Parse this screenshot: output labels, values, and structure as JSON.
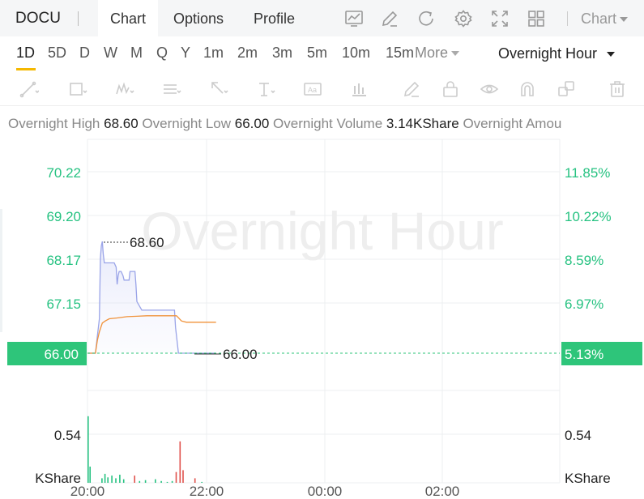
{
  "header": {
    "symbol": "DOCU",
    "tabs": [
      {
        "label": "Chart",
        "active": true
      },
      {
        "label": "Options",
        "active": false
      },
      {
        "label": "Profile",
        "active": false
      }
    ],
    "icons": [
      "chart-line-icon",
      "pencil-icon",
      "refresh-icon",
      "gear-icon",
      "fullscreen-icon",
      "grid-layout-icon"
    ],
    "chart_selector": "Chart"
  },
  "periods": {
    "items": [
      "1D",
      "5D",
      "D",
      "W",
      "M",
      "Q",
      "Y",
      "1m",
      "2m",
      "3m",
      "5m",
      "10m",
      "15m"
    ],
    "active": "1D",
    "more_label": "More",
    "session_label": "Overnight Hour"
  },
  "drawing_tools": [
    "trend-line-icon",
    "rectangle-icon",
    "wave-icon",
    "fib-icon",
    "arrow-icon",
    "text-cursor-icon",
    "text-note-icon",
    "bar-stat-icon",
    "brush-icon",
    "lock-icon",
    "eye-icon",
    "magnet-icon",
    "layers-icon",
    "trash-icon"
  ],
  "stats": {
    "high_label": "Overnight High",
    "high_value": "68.60",
    "low_label": "Overnight Low",
    "low_value": "66.00",
    "volume_label": "Overnight Volume",
    "volume_value": "3.14KShare",
    "amount_label": "Overnight Amou"
  },
  "colors": {
    "up": "#26c281",
    "down": "#e0524c",
    "price_line": "#9aa4e8",
    "avg_line": "#f0923a",
    "last_price_bg": "#2ec57a"
  },
  "chart_data": {
    "type": "line",
    "watermark": "Overnight Hour",
    "price_axis_ticks": [
      "70.22",
      "69.20",
      "68.17",
      "67.15"
    ],
    "percent_axis_ticks": [
      "11.85%",
      "10.22%",
      "8.59%",
      "6.97%"
    ],
    "last_price": "66.00",
    "last_percent": "5.13%",
    "high_marker": "68.60",
    "low_marker": "66.00",
    "volume_tick": "0.54",
    "volume_unit": "KShare",
    "time_ticks": [
      "20:00",
      "22:00",
      "00:00",
      "02:00"
    ],
    "price_series": [
      [
        0,
        66.0
      ],
      [
        4,
        66.0
      ],
      [
        8,
        66.0
      ],
      [
        10,
        66.4
      ],
      [
        12,
        66.8
      ],
      [
        13,
        68.2
      ],
      [
        14,
        68.5
      ],
      [
        15,
        68.6
      ],
      [
        16,
        68.3
      ],
      [
        17,
        68.1
      ],
      [
        19,
        68.1
      ],
      [
        21,
        68.1
      ],
      [
        23,
        68.1
      ],
      [
        25,
        68.1
      ],
      [
        27,
        68.1
      ],
      [
        29,
        68.0
      ],
      [
        30,
        67.6
      ],
      [
        31,
        67.8
      ],
      [
        32,
        67.9
      ],
      [
        33,
        67.9
      ],
      [
        34,
        67.9
      ],
      [
        36,
        67.8
      ],
      [
        37,
        67.7
      ],
      [
        38,
        67.7
      ],
      [
        40,
        67.7
      ],
      [
        42,
        67.7
      ],
      [
        43,
        67.9
      ],
      [
        44,
        67.9
      ],
      [
        46,
        67.9
      ],
      [
        48,
        67.9
      ],
      [
        49,
        67.6
      ],
      [
        50,
        67.2
      ],
      [
        55,
        67.0
      ],
      [
        62,
        67.0
      ],
      [
        70,
        67.0
      ],
      [
        78,
        67.0
      ],
      [
        85,
        67.0
      ],
      [
        88,
        67.0
      ],
      [
        89,
        66.6
      ],
      [
        92,
        66.0
      ],
      [
        100,
        66.0
      ],
      [
        115,
        66.0
      ],
      [
        130,
        66.0
      ]
    ],
    "avg_series": [
      [
        0,
        66.0
      ],
      [
        4,
        66.0
      ],
      [
        8,
        66.0
      ],
      [
        10,
        66.3
      ],
      [
        12,
        66.5
      ],
      [
        15,
        66.7
      ],
      [
        18,
        66.75
      ],
      [
        22,
        66.8
      ],
      [
        30,
        66.82
      ],
      [
        40,
        66.85
      ],
      [
        50,
        66.86
      ],
      [
        60,
        66.87
      ],
      [
        70,
        66.87
      ],
      [
        80,
        66.87
      ],
      [
        90,
        66.87
      ],
      [
        95,
        66.75
      ],
      [
        100,
        66.72
      ],
      [
        110,
        66.72
      ],
      [
        120,
        66.72
      ],
      [
        130,
        66.72
      ]
    ],
    "volume_bars": [
      {
        "t": 0,
        "v": 0.74,
        "dir": "up"
      },
      {
        "t": 2,
        "v": 0.18,
        "dir": "up"
      },
      {
        "t": 14,
        "v": 0.05,
        "dir": "up"
      },
      {
        "t": 17,
        "v": 0.1,
        "dir": "up"
      },
      {
        "t": 20,
        "v": 0.06,
        "dir": "up"
      },
      {
        "t": 24,
        "v": 0.08,
        "dir": "up"
      },
      {
        "t": 28,
        "v": 0.05,
        "dir": "up"
      },
      {
        "t": 32,
        "v": 0.09,
        "dir": "up"
      },
      {
        "t": 36,
        "v": 0.04,
        "dir": "up"
      },
      {
        "t": 47,
        "v": 0.08,
        "dir": "down"
      },
      {
        "t": 52,
        "v": 0.02,
        "dir": "up"
      },
      {
        "t": 58,
        "v": 0.03,
        "dir": "up"
      },
      {
        "t": 68,
        "v": 0.04,
        "dir": "up"
      },
      {
        "t": 74,
        "v": 0.02,
        "dir": "up"
      },
      {
        "t": 80,
        "v": 0.01,
        "dir": "up"
      },
      {
        "t": 85,
        "v": 0.02,
        "dir": "up"
      },
      {
        "t": 89,
        "v": 0.12,
        "dir": "down"
      },
      {
        "t": 93,
        "v": 0.46,
        "dir": "down"
      },
      {
        "t": 96,
        "v": 0.14,
        "dir": "down"
      },
      {
        "t": 108,
        "v": 0.05,
        "dir": "down"
      },
      {
        "t": 115,
        "v": 0.01,
        "dir": "up"
      }
    ],
    "ylim": [
      65.3,
      70.9
    ],
    "volume_ylim": [
      0,
      0.85
    ]
  }
}
